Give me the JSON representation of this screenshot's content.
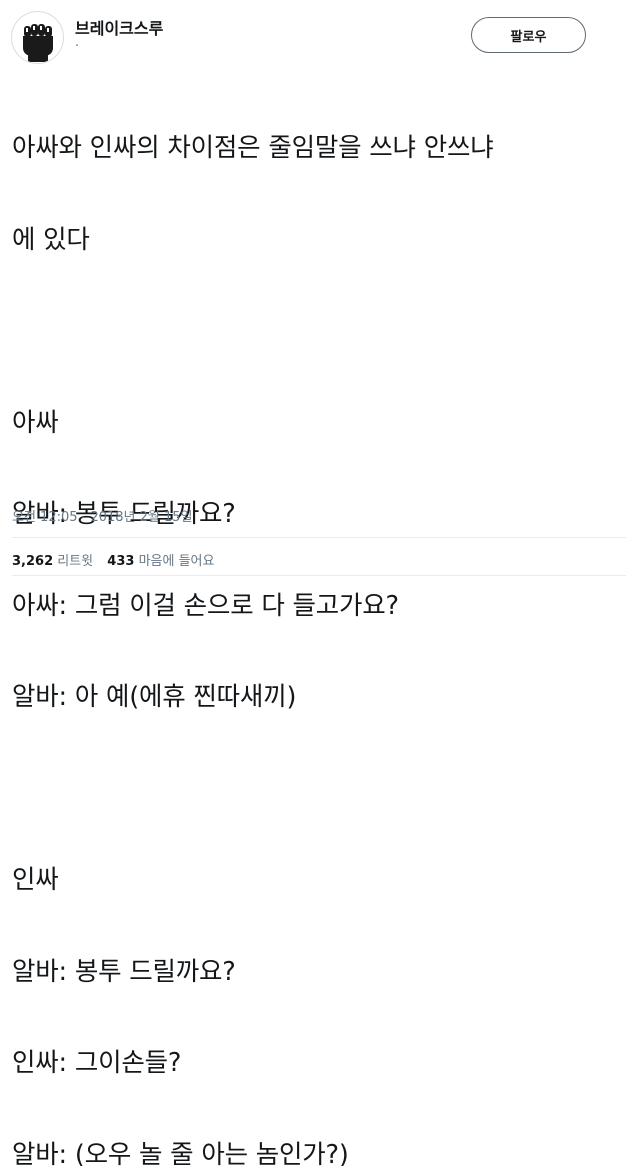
{
  "author": {
    "display_name": "브레이크스루",
    "handle": "·",
    "avatar_icon": "fist-icon"
  },
  "follow_button": {
    "label": "팔로우"
  },
  "tweet": {
    "lines": [
      "아싸와 인싸의 차이점은 줄임말을 쓰냐 안쓰냐",
      "에 있다",
      "",
      "아싸",
      "알바: 봉투 드릴까요?",
      "아싸: 그럼 이걸 손으로 다 들고가요?",
      "알바: 아 예(에휴 찐따새끼)",
      "",
      "인싸",
      "알바: 봉투 드릴까요?",
      "인싸: 그이손들?",
      "알바: (오우 놀 줄 아는 놈인가?)"
    ],
    "timestamp": "오전 12:05 - 2018년 2월 15일"
  },
  "stats": {
    "retweets_count": "3,262",
    "retweets_label": "리트윗",
    "likes_count": "433",
    "likes_label": "마음에 들어요"
  }
}
